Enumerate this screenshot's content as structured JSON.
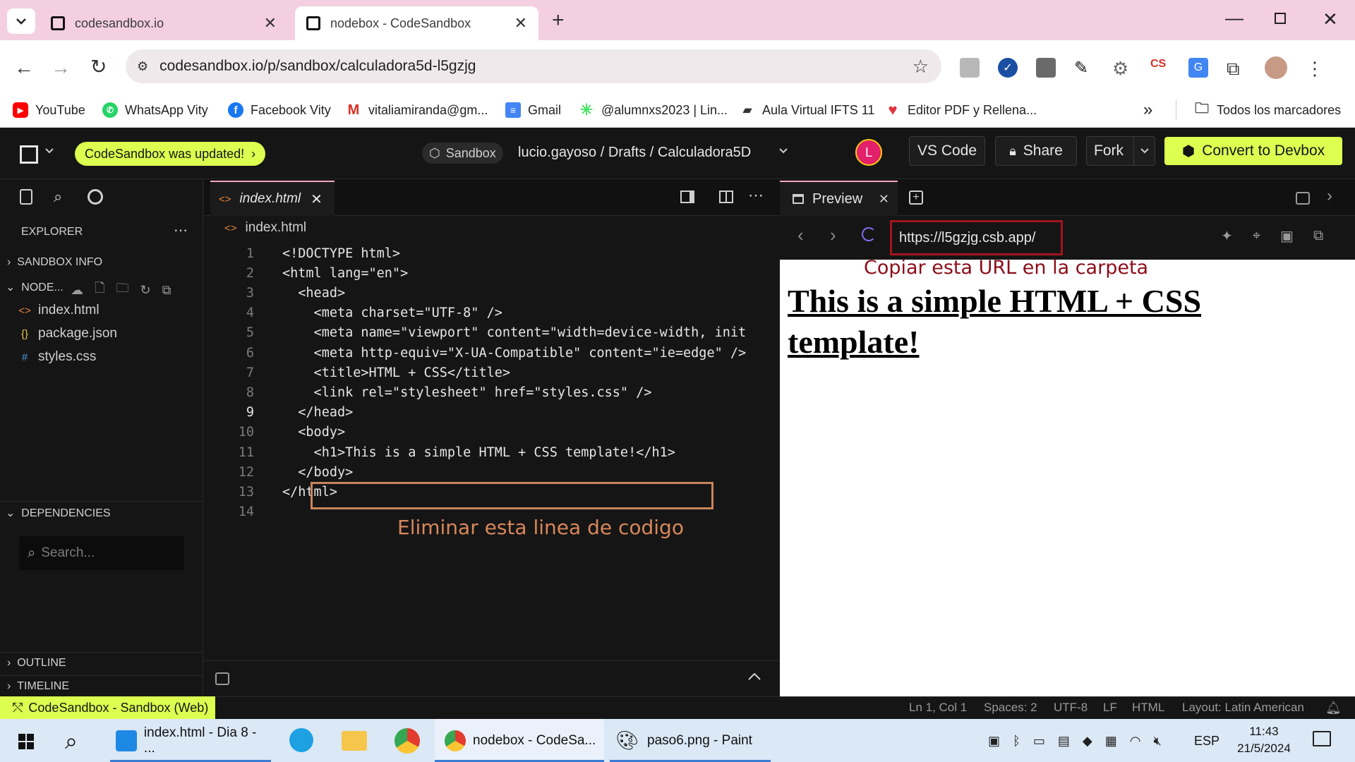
{
  "browser": {
    "tabs": [
      {
        "title": "codesandbox.io"
      },
      {
        "title": "nodebox - CodeSandbox"
      }
    ],
    "url": "codesandbox.io/p/sandbox/calculadora5d-l5gzjg",
    "bookmarks": [
      {
        "label": "YouTube",
        "icon": "youtube-icon"
      },
      {
        "label": "WhatsApp Vity",
        "icon": "whatsapp-icon"
      },
      {
        "label": "Facebook Vity",
        "icon": "facebook-icon"
      },
      {
        "label": "vitaliamiranda@gm...",
        "icon": "gmail-icon"
      },
      {
        "label": "Gmail",
        "icon": "docs-icon"
      },
      {
        "label": "@alumnxs2023 | Lin...",
        "icon": "linktree-icon"
      },
      {
        "label": "Aula Virtual IFTS 11",
        "icon": "moodle-icon"
      },
      {
        "label": "Editor PDF y Rellena...",
        "icon": "heart-icon"
      }
    ],
    "all_bookmarks": "Todos los marcadores"
  },
  "csb": {
    "updated_pill": "CodeSandbox was updated!",
    "sandbox_badge": "Sandbox",
    "breadcrumb": "lucio.gayoso / Drafts / Calculadora5D",
    "avatar_letter": "L",
    "vscode_label": "VS Code",
    "share_label": "Share",
    "fork_label": "Fork",
    "devbox_label": "Convert to Devbox"
  },
  "sidebar": {
    "explorer_title": "EXPLORER",
    "sandbox_info": "SANDBOX INFO",
    "folder": "NODE...",
    "files": [
      {
        "name": "index.html",
        "icon": "<>"
      },
      {
        "name": "package.json",
        "icon": "{}"
      },
      {
        "name": "styles.css",
        "icon": "#"
      }
    ],
    "dependencies": "DEPENDENCIES",
    "search_placeholder": "Search...",
    "outline": "OUTLINE",
    "timeline": "TIMELINE"
  },
  "editor": {
    "tab_label": "index.html",
    "breadcrumb": "index.html",
    "lines": [
      {
        "n": "1",
        "code": "<!DOCTYPE html>"
      },
      {
        "n": "2",
        "code": "<html lang=\"en\">"
      },
      {
        "n": "3",
        "code": "  <head>"
      },
      {
        "n": "4",
        "code": "    <meta charset=\"UTF-8\" />"
      },
      {
        "n": "5",
        "code": "    <meta name=\"viewport\" content=\"width=device-width, init"
      },
      {
        "n": "6",
        "code": "    <meta http-equiv=\"X-UA-Compatible\" content=\"ie=edge\" />"
      },
      {
        "n": "7",
        "code": "    <title>HTML + CSS</title>"
      },
      {
        "n": "8",
        "code": "    <link rel=\"stylesheet\" href=\"styles.css\" />"
      },
      {
        "n": "9",
        "code": "  </head>"
      },
      {
        "n": "10",
        "code": "  <body>"
      },
      {
        "n": "11",
        "code": "    <h1>This is a simple HTML + CSS template!</h1>"
      },
      {
        "n": "12",
        "code": "  </body>"
      },
      {
        "n": "13",
        "code": "</html>"
      },
      {
        "n": "14",
        "code": ""
      }
    ],
    "annotation": "Eliminar esta linea de codigo"
  },
  "preview": {
    "tab_label": "Preview",
    "url": "https://l5gzjg.csb.app/",
    "annotation": "Copiar esta URL en la carpeta",
    "heading": "This is a simple HTML + CSS template!"
  },
  "status": {
    "left": "CodeSandbox - Sandbox (Web)",
    "position": "Ln 1, Col 1",
    "spaces": "Spaces: 2",
    "encoding": "UTF-8",
    "eol": "LF",
    "language": "HTML",
    "layout": "Layout: Latin American"
  },
  "taskbar": {
    "apps": [
      {
        "label": "index.html - Dia 8 - ..."
      },
      {
        "label": "nodebox - CodeSa..."
      },
      {
        "label": "paso6.png - Paint"
      }
    ],
    "lang": "ESP",
    "time": "11:43",
    "date": "21/5/2024"
  },
  "colors": {
    "accent": "#dcff50",
    "annotation_red": "#a3141d",
    "annotation_orange": "#c9855b"
  }
}
